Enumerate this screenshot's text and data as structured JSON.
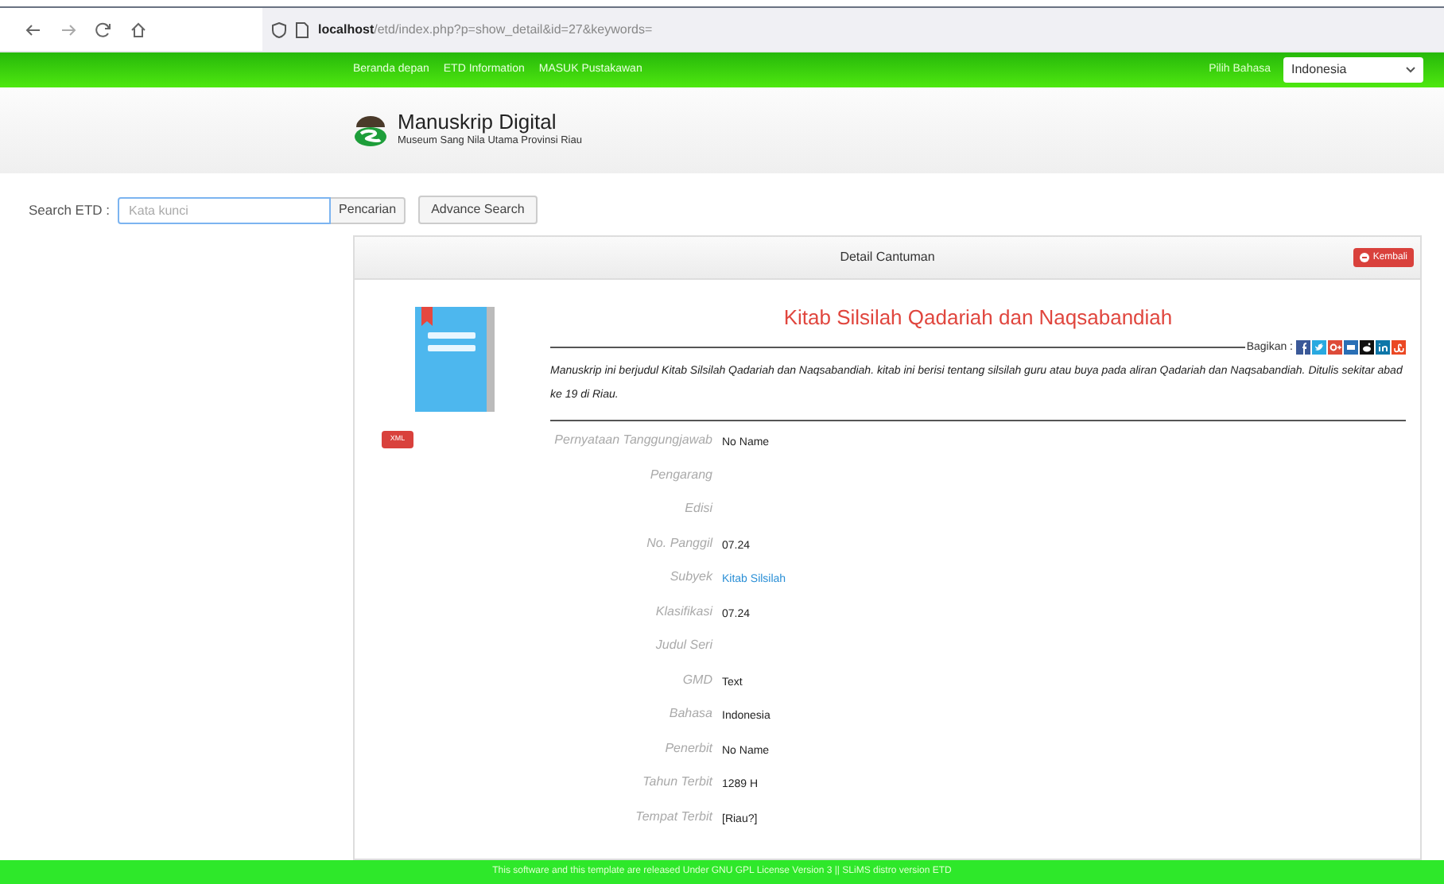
{
  "browser": {
    "url_host": "localhost",
    "url_path": "/etd/index.php?p=show_detail&id=27&keywords="
  },
  "nav": {
    "links": [
      "Beranda depan",
      "ETD Information",
      "MASUK Pustakawan"
    ],
    "language_label": "Pilih Bahasa",
    "language": "Indonesia"
  },
  "header": {
    "title": "Manuskrip Digital",
    "subtitle": "Museum Sang Nila Utama Provinsi Riau"
  },
  "search": {
    "label": "Search ETD :",
    "placeholder": "Kata kunci",
    "button": "Pencarian",
    "advanced": "Advance Search"
  },
  "detail": {
    "heading": "Detail Cantuman",
    "back": "Kembali",
    "xml": "XML",
    "title": "Kitab Silsilah Qadariah dan Naqsabandiah",
    "share_label": "Bagikan :",
    "description": "Manuskrip ini berjudul Kitab Silsilah Qadariah dan Naqsabandiah. kitab ini berisi tentang silsilah guru atau buya pada aliran Qadariah dan Naqsabandiah. Ditulis sekitar abad ke 19 di Riau.",
    "fields": [
      {
        "label": "Pernyataan Tanggungjawab",
        "value": "No Name",
        "kind": "text"
      },
      {
        "label": "Pengarang"
      },
      {
        "label": "Edisi"
      },
      {
        "label": "No. Panggil",
        "value": "07.24",
        "kind": "text"
      },
      {
        "label": "Subyek",
        "value": "Kitab Silsilah",
        "kind": "link"
      },
      {
        "label": "Klasifikasi",
        "value": "07.24",
        "kind": "text"
      },
      {
        "label": "Judul Seri"
      },
      {
        "label": "GMD",
        "value": "Text",
        "kind": "text"
      },
      {
        "label": "Bahasa",
        "value": "Indonesia",
        "kind": "text"
      },
      {
        "label": "Penerbit",
        "value": "No Name",
        "kind": "text"
      },
      {
        "label": "Tahun Terbit",
        "value": "1289 H",
        "kind": "text"
      },
      {
        "label": "Tempat Terbit",
        "value": "[Riau?]",
        "kind": "text"
      }
    ]
  },
  "footer": "This software and this template are released Under GNU GPL License Version 3 || SLiMS distro version ETD"
}
